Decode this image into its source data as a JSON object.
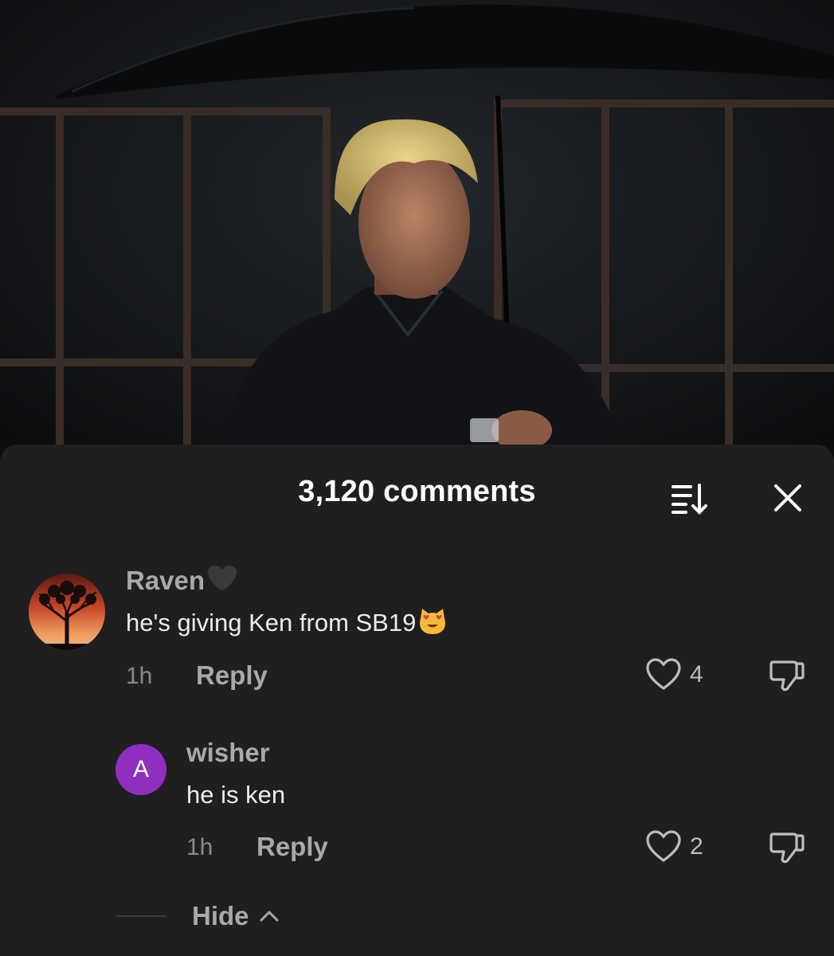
{
  "header": {
    "title": "3,120 comments",
    "sort_icon": "sort-icon",
    "close_icon": "close-icon"
  },
  "comments": [
    {
      "username": "Raven",
      "username_emoji": "black-heart-icon",
      "text": "he's giving Ken from SB19",
      "text_emoji": "heart-eyes-cat-icon",
      "time": "1h",
      "reply_label": "Reply",
      "likes": "4",
      "avatar": "tree-sunset-avatar"
    },
    {
      "username": "wisher",
      "text": "he is ken",
      "time": "1h",
      "reply_label": "Reply",
      "likes": "2",
      "avatar_letter": "A"
    }
  ],
  "hide_label": "Hide",
  "colors": {
    "sheet_bg": "#1f1f1f",
    "username": "#a9a9a9",
    "text": "#ececec",
    "avatar_purple": "#8e2fbf"
  }
}
